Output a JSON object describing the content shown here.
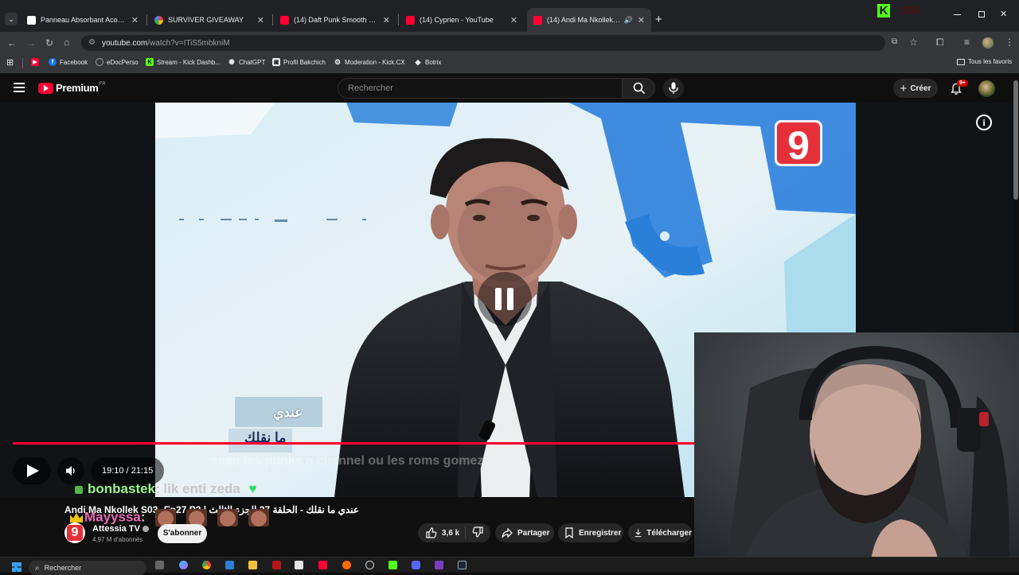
{
  "browser": {
    "tabs": [
      {
        "title": "Panneau Absorbant Acoustique",
        "favicon": "site-icon",
        "fav_color": "#ffffff"
      },
      {
        "title": "SURVIVER GIVEAWAY",
        "favicon": "giveaway-icon",
        "fav_color": "#4285f4"
      },
      {
        "title": "(14) Daft Punk Smooth Galaxy",
        "favicon": "youtube-icon",
        "fav_color": "#ff0033"
      },
      {
        "title": "(14) Cyprien - YouTube",
        "favicon": "youtube-icon",
        "fav_color": "#ff0033"
      },
      {
        "title": "(14) Andi Ma Nkollek S03-",
        "favicon": "youtube-icon",
        "fav_color": "#ff0033"
      }
    ],
    "kick_counter": "156",
    "url_main": "youtube.com",
    "url_rest": "/watch?v=ITiS5mbkniM",
    "bookmarks": [
      {
        "label": "",
        "icon": "youtube-icon",
        "color": "#ff0033"
      },
      {
        "label": "Facebook",
        "icon": "facebook-icon",
        "color": "#1877f2"
      },
      {
        "label": "eDocPerso",
        "icon": "edocperso-icon",
        "color": "#9aa0a6"
      },
      {
        "label": "Stream - Kick Dashb...",
        "icon": "kick-icon",
        "color": "#53fc18"
      },
      {
        "label": "ChatGPT",
        "icon": "chatgpt-icon",
        "color": "#9aa0a6"
      },
      {
        "label": "Profil Bakchich",
        "icon": "profile-icon",
        "color": "#8ab4f8"
      },
      {
        "label": "Moderation - Kick.CX",
        "icon": "moderation-icon",
        "color": "#9aa0a6"
      },
      {
        "label": "Botrix",
        "icon": "botrix-icon",
        "color": "#e8eaed"
      }
    ],
    "all_favorites": "Tous les favoris"
  },
  "youtube": {
    "logo_text": "Premium",
    "logo_region": "FR",
    "search_placeholder": "Rechercher",
    "create_label": "Créer",
    "notification_badge": "9+",
    "colors": {
      "brand_red": "#ff0033",
      "progress_red": "#f03"
    },
    "player": {
      "time_display": "19:10 / 21:15",
      "progress": 0.9,
      "state": "paused",
      "channel_bug": "9"
    },
    "video": {
      "title": "Andi Ma Nkollek S03- Ep27 P3 | عندي ما نقلك - الحلقة 27 الجزء الثالث",
      "channel_name": "Attessia TV",
      "subscribers": "4,97 M d'abonnés",
      "subscribe_label": "S'abonner",
      "likes": "3,6 k",
      "share_label": "Partager",
      "save_label": "Enregistrer",
      "download_label": "Télécharger"
    },
    "overlay_text": {
      "tv_logo_line1": "عندي",
      "tv_logo_line2": "ما نقلك",
      "caption_ghost": "ssan les punks a channel ou les roms gomez"
    }
  },
  "chat": [
    {
      "user": "bonbastek",
      "message": ": lik enti zeda",
      "user_color": "#9bf08a",
      "emote": "green-heart"
    },
    {
      "user": "Mayyssa",
      "message": ":",
      "user_color": "#e96bb6",
      "emote": "face-emotes"
    }
  ],
  "taskbar": {
    "search_placeholder": "Rechercher"
  }
}
